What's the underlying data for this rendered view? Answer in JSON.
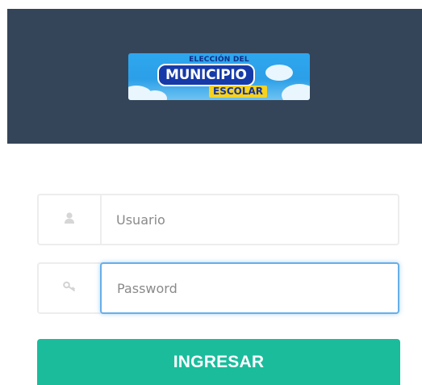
{
  "logo": {
    "line1": "ELECCIÓN DEL",
    "line2": "MUNICIPIO",
    "line3": "ESCOLAR"
  },
  "form": {
    "username": {
      "placeholder": "Usuario",
      "value": "",
      "icon": "user-icon"
    },
    "password": {
      "placeholder": "Password",
      "value": "",
      "icon": "key-icon",
      "focused": true
    },
    "submit_label": "INGRESAR"
  },
  "colors": {
    "header_bg": "#354559",
    "button_bg": "#1abc9c",
    "focus_border": "#66afe9",
    "input_border": "#ededed"
  }
}
